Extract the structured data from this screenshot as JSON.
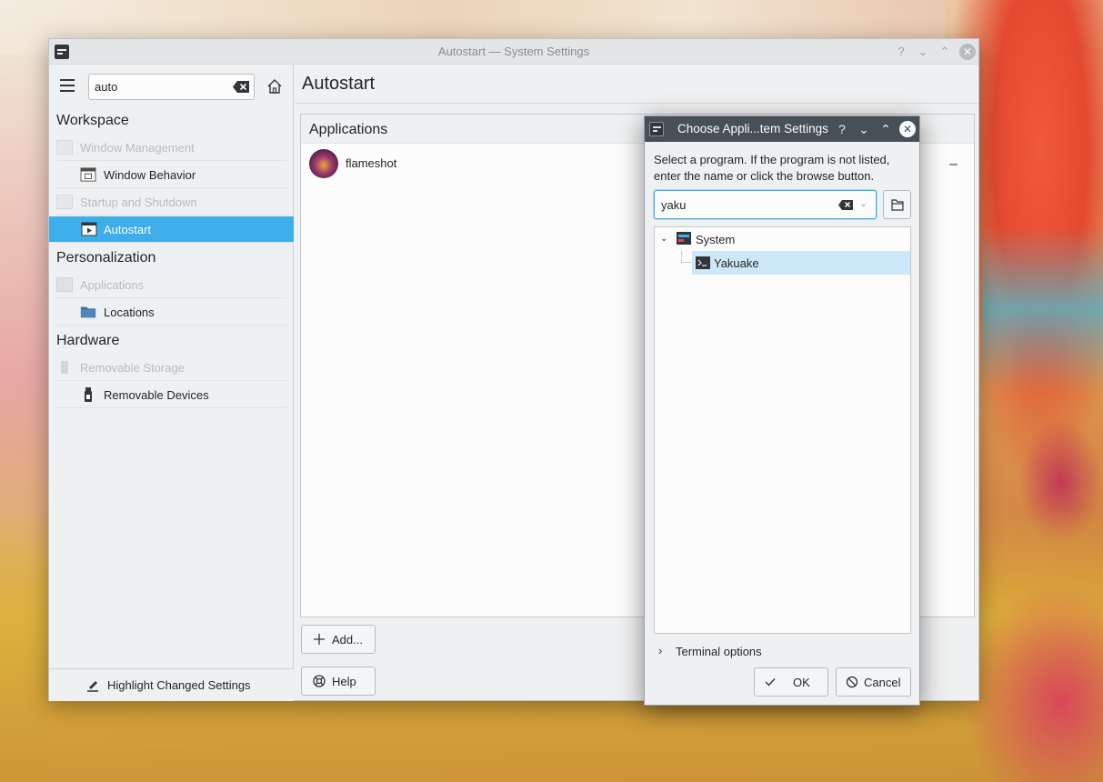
{
  "window": {
    "title": "Autostart — System Settings"
  },
  "sidebar": {
    "search_value": "auto",
    "categories": [
      {
        "label": "Workspace"
      },
      {
        "label": "Personalization"
      },
      {
        "label": "Hardware"
      }
    ],
    "items": [
      {
        "label": "Window Management",
        "state": "muted"
      },
      {
        "label": "Window Behavior",
        "state": "sub"
      },
      {
        "label": "Startup and Shutdown",
        "state": "muted"
      },
      {
        "label": "Autostart",
        "state": "selected"
      },
      {
        "label": "Applications",
        "state": "muted"
      },
      {
        "label": "Locations",
        "state": "sub"
      },
      {
        "label": "Removable Storage",
        "state": "muted"
      },
      {
        "label": "Removable Devices",
        "state": "sub"
      }
    ],
    "highlight_label": "Highlight Changed Settings"
  },
  "content": {
    "title": "Autostart",
    "section_title": "Applications",
    "apps": [
      {
        "name": "flameshot"
      }
    ],
    "add_label": "Add...",
    "help_label": "Help"
  },
  "dialog": {
    "title": "Choose Appli...tem Settings",
    "description": "Select a program. If the program is not listed, enter the name or click the browse button.",
    "search_value": "yaku",
    "tree": [
      {
        "label": "System",
        "expanded": true
      },
      {
        "label": "Yakuake",
        "selected": true
      }
    ],
    "terminal_options_label": "Terminal options",
    "ok_label": "OK",
    "cancel_label": "Cancel"
  },
  "colors": {
    "accent": "#3daee9",
    "dialog_title_bg": "#475057",
    "window_bg": "#eff0f1",
    "selection_light": "#cde8f8"
  }
}
